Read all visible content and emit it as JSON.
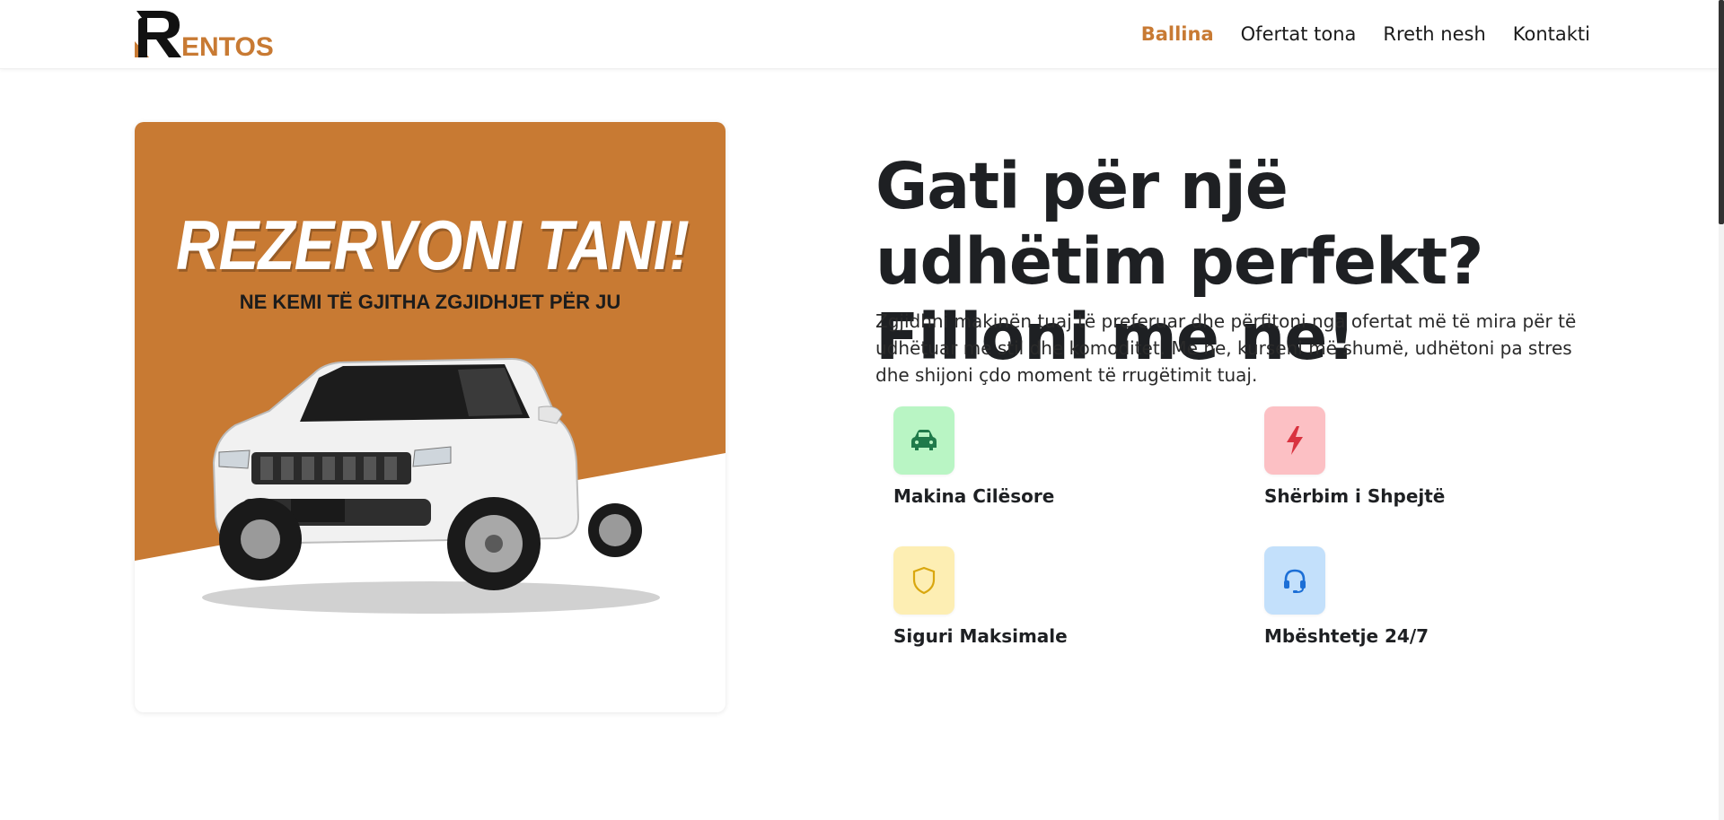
{
  "brand": {
    "name": "ENTOS",
    "accent_color": "#c87a33"
  },
  "nav": {
    "items": [
      {
        "label": "Ballina",
        "active": true
      },
      {
        "label": "Ofertat tona",
        "active": false
      },
      {
        "label": "Rreth nesh",
        "active": false
      },
      {
        "label": "Kontakti",
        "active": false
      }
    ]
  },
  "promo": {
    "headline": "REZERVONI TANI!",
    "subheadline": "NE KEMI TË GJITHA ZGJIDHJET PËR JU",
    "image": "white-suv",
    "background_color": "#c87a33"
  },
  "hero": {
    "title": "Gati për një udhëtim perfekt? Filloni me ne!",
    "description": "Zgjidhni makinën tuaj të preferuar dhe përfitoni nga ofertat më të mira për të udhëtuar me stil dhe komoditet. Me ne, kurseni më shumë, udhëtoni pa stres dhe shijoni çdo moment të rrugëtimit tuaj."
  },
  "features": [
    {
      "label": "Makina Cilësore",
      "icon": "car-icon",
      "bg": "#b9f5c4",
      "fg": "#1f7a4a"
    },
    {
      "label": "Shërbim i Shpejtë",
      "icon": "bolt-icon",
      "bg": "#fcc0c4",
      "fg": "#d9323f"
    },
    {
      "label": "Siguri Maksimale",
      "icon": "shield-icon",
      "bg": "#fdeeb3",
      "fg": "#d9a70f"
    },
    {
      "label": "Mbështetje 24/7",
      "icon": "headset-icon",
      "bg": "#c3e0fb",
      "fg": "#1c6fd6"
    }
  ]
}
